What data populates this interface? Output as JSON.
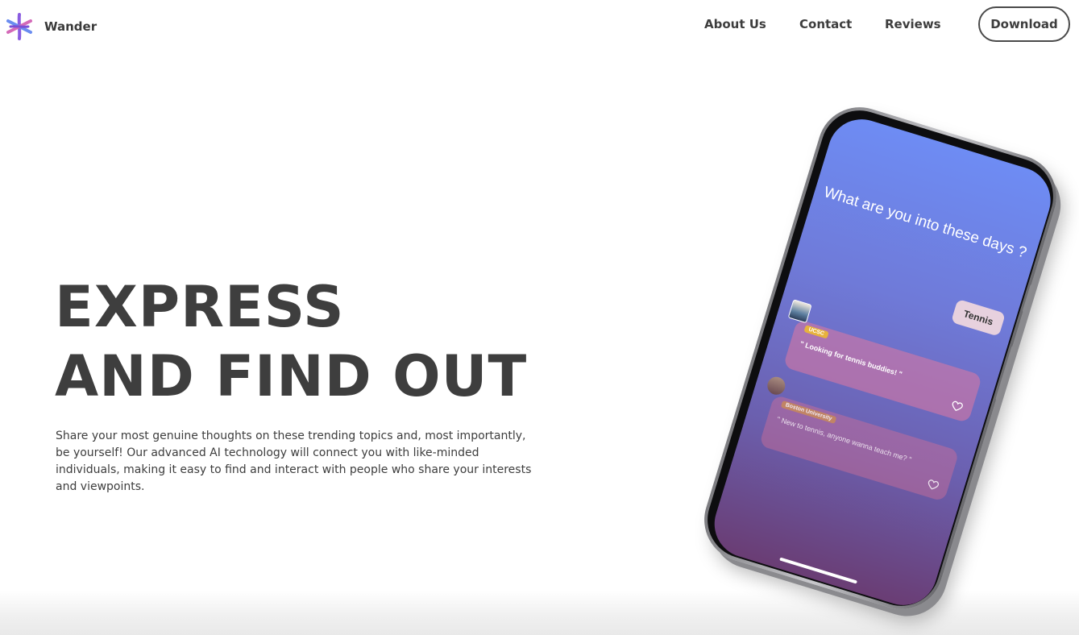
{
  "header": {
    "brand_name": "Wander",
    "logo_icon": "asterisk-logo-icon",
    "nav": [
      {
        "label": "About Us"
      },
      {
        "label": "Contact"
      },
      {
        "label": "Reviews"
      }
    ],
    "download_label": "Download"
  },
  "hero": {
    "title_line1": "EXPRESS",
    "title_line2": "AND FIND OUT",
    "description": "Share your most genuine thoughts on these trending topics and, most importantly, be yourself! Our advanced AI technology will connect you with like-minded individuals, making it easy to find and interact with people who share your interests and viewpoints."
  },
  "phone_screen": {
    "question": "What are you into these days ?",
    "selected_interest": "Tennis",
    "posts": [
      {
        "school": "UCSC",
        "text": "\" Looking for tennis buddies! \""
      },
      {
        "school": "Boston University",
        "text": "\" New to tennis, anyone wanna teach me? \""
      }
    ]
  },
  "colors": {
    "text": "#3d3d3d",
    "screen_top": "#6e8cf4",
    "screen_bottom": "#6a3d74",
    "logo_purple": "#7b4fd6",
    "logo_pink": "#d46ab8",
    "logo_blue": "#6a8cf0"
  }
}
